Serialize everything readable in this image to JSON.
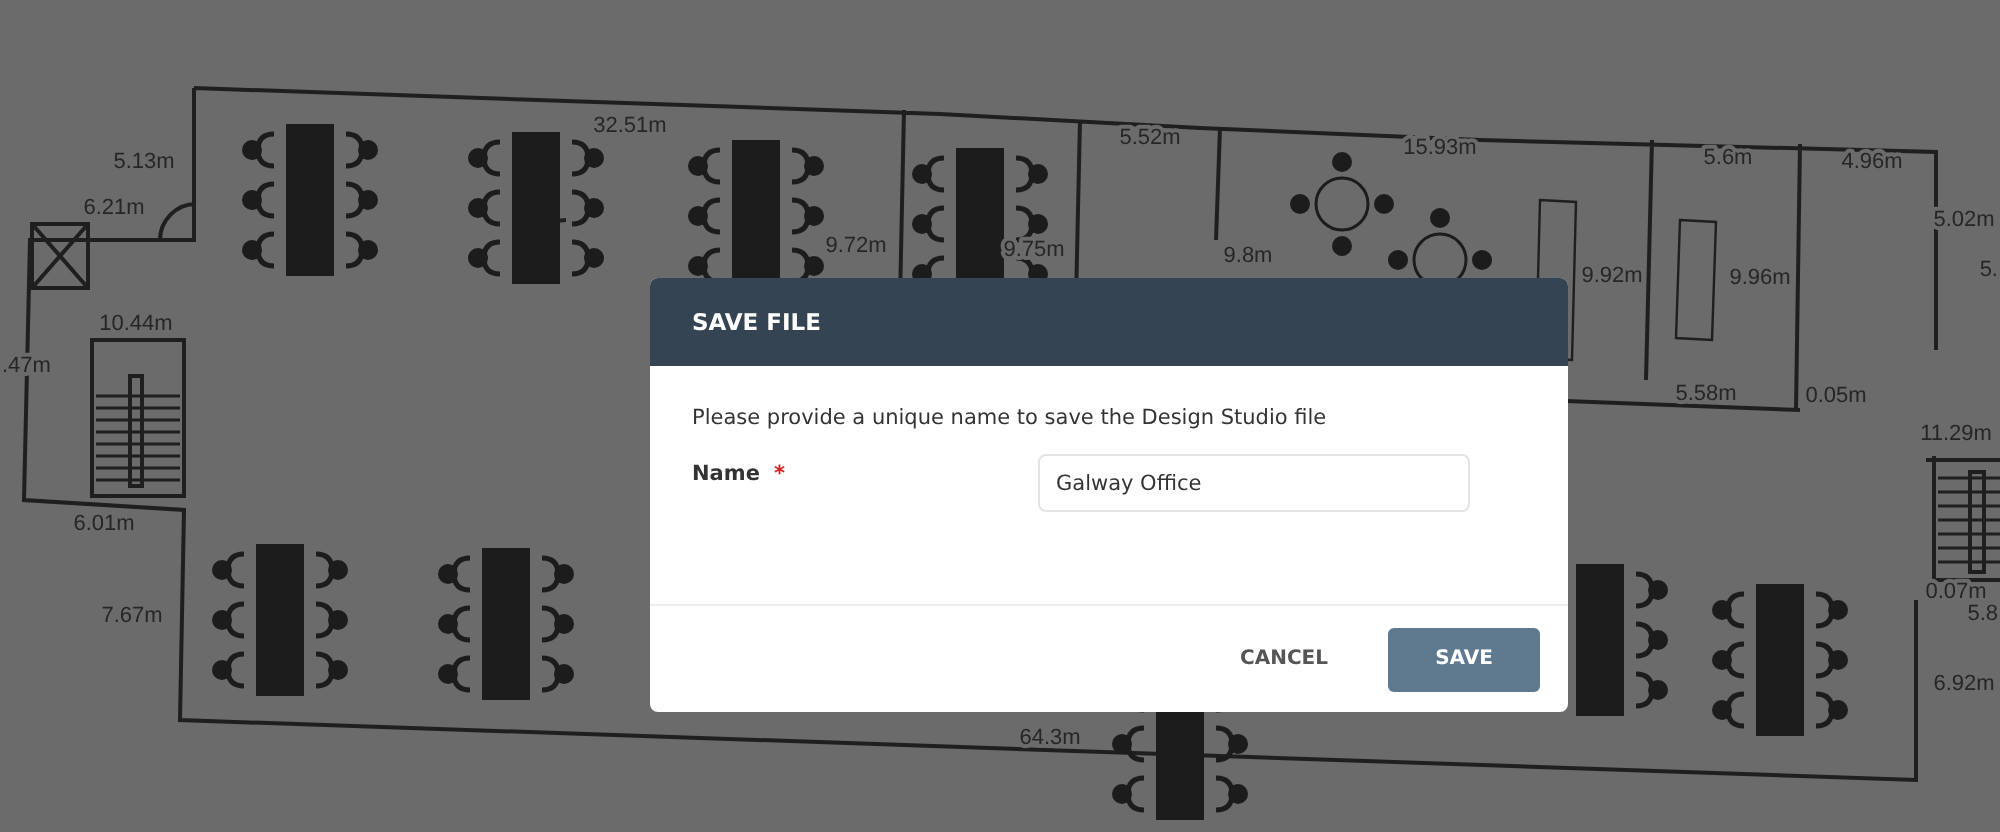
{
  "floor_plan": {
    "dimension_labels": [
      "32.51m",
      "5.13m",
      "6.21m",
      "9.72m",
      "9.75m",
      "5.52m",
      "15.93m",
      "9.8m",
      "5.6m",
      "4.96m",
      "5.02m",
      "9.92m",
      "9.96m",
      "5.58m",
      "0.05m",
      "11.29m",
      ".47m",
      "10.44m",
      "6.01m",
      "7.67m",
      "0.07m",
      "5.8",
      "6.92m",
      "64.3m",
      "5."
    ]
  },
  "dialog": {
    "title": "SAVE FILE",
    "message": "Please provide a unique name to save the Design Studio file",
    "field": {
      "label": "Name",
      "required_mark": "*",
      "value": "Galway Office"
    },
    "buttons": [
      {
        "label": "CANCEL",
        "kind": "text"
      },
      {
        "label": "SAVE",
        "kind": "primary"
      }
    ]
  }
}
